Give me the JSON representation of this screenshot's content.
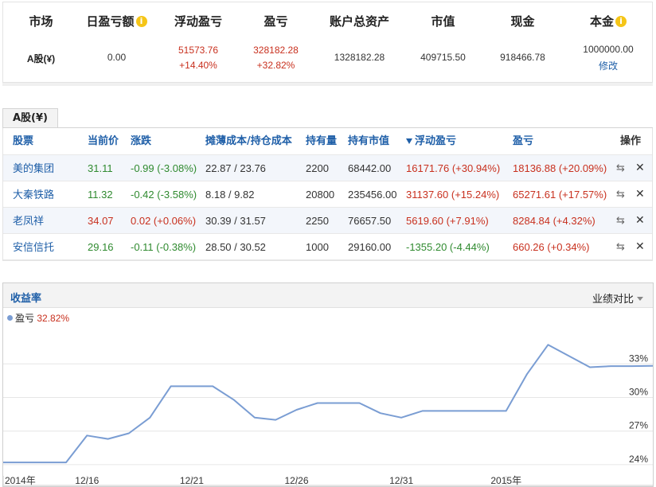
{
  "summary": {
    "headers": {
      "market": "市场",
      "daily_pnl": "日盈亏额",
      "floating_pnl": "浮动盈亏",
      "pnl": "盈亏",
      "total_assets": "账户总资产",
      "market_value": "市值",
      "cash": "现金",
      "principal": "本金"
    },
    "info_icon": "i",
    "values": {
      "market": "A股(¥)",
      "daily_pnl": "0.00",
      "floating_pnl": "51573.76",
      "floating_pnl_pct": "+14.40%",
      "pnl": "328182.28",
      "pnl_pct": "+32.82%",
      "total_assets": "1328182.28",
      "market_value": "409715.50",
      "cash": "918466.78",
      "principal": "1000000.00",
      "edit": "修改"
    }
  },
  "holdings": {
    "tab": "A股(¥)",
    "headers": {
      "stock": "股票",
      "price": "当前价",
      "change": "涨跌",
      "cost": "摊薄成本/持仓成本",
      "qty": "持有量",
      "value": "持有市值",
      "floating": "浮动盈亏",
      "pnl": "盈亏",
      "ops": "操作"
    },
    "rows": [
      {
        "name": "美的集团",
        "price": "31.11",
        "change": "-0.99 (-3.08%)",
        "cost": "22.87 / 23.76",
        "qty": "2200",
        "value": "68442.00",
        "floating": "16171.76 (+30.94%)",
        "pnl": "18136.88 (+20.09%)",
        "price_color": "green",
        "change_color": "green",
        "floating_color": "red",
        "pnl_color": "red"
      },
      {
        "name": "大秦铁路",
        "price": "11.32",
        "change": "-0.42 (-3.58%)",
        "cost": "8.18 / 9.82",
        "qty": "20800",
        "value": "235456.00",
        "floating": "31137.60 (+15.24%)",
        "pnl": "65271.61 (+17.57%)",
        "price_color": "green",
        "change_color": "green",
        "floating_color": "red",
        "pnl_color": "red"
      },
      {
        "name": "老凤祥",
        "price": "34.07",
        "change": "0.02 (+0.06%)",
        "cost": "30.39 / 31.57",
        "qty": "2250",
        "value": "76657.50",
        "floating": "5619.60 (+7.91%)",
        "pnl": "8284.84 (+4.32%)",
        "price_color": "red",
        "change_color": "red",
        "floating_color": "red",
        "pnl_color": "red"
      },
      {
        "name": "安信信托",
        "price": "29.16",
        "change": "-0.11 (-0.38%)",
        "cost": "28.50 / 30.52",
        "qty": "1000",
        "value": "29160.00",
        "floating": "-1355.20 (-4.44%)",
        "pnl": "660.26 (+0.34%)",
        "price_color": "green",
        "change_color": "green",
        "floating_color": "green",
        "pnl_color": "red"
      }
    ],
    "op_icons": [
      "transfer-icon",
      "close-icon"
    ]
  },
  "chart_panel": {
    "title": "收益率",
    "compare_label": "业绩对比",
    "legend_name": "盈亏",
    "legend_value": "32.82%"
  },
  "chart_data": {
    "type": "line",
    "x": [
      "2014-12-12",
      "2014-12-13",
      "2014-12-14",
      "2014-12-15",
      "2014-12-16",
      "2014-12-17",
      "2014-12-18",
      "2014-12-19",
      "2014-12-20",
      "2014-12-21",
      "2014-12-22",
      "2014-12-23",
      "2014-12-24",
      "2014-12-25",
      "2014-12-26",
      "2014-12-27",
      "2014-12-28",
      "2014-12-29",
      "2014-12-30",
      "2014-12-31",
      "2015-01-01",
      "2015-01-02",
      "2015-01-03",
      "2015-01-04",
      "2015-01-05",
      "2015-01-06",
      "2015-01-07",
      "2015-01-08",
      "2015-01-09",
      "2015-01-10",
      "2015-01-11",
      "2015-01-12"
    ],
    "series": [
      {
        "name": "盈亏",
        "values": [
          24.2,
          24.2,
          24.2,
          24.2,
          26.6,
          26.3,
          26.8,
          28.2,
          31.0,
          31.0,
          31.0,
          29.8,
          28.2,
          28.0,
          28.9,
          29.5,
          29.5,
          29.5,
          28.6,
          28.2,
          28.8,
          28.8,
          28.8,
          28.8,
          28.8,
          32.1,
          34.7,
          33.7,
          32.7,
          32.8,
          32.8,
          32.82
        ]
      }
    ],
    "x_ticks": [
      {
        "x": "2014-12-12",
        "label": "2014年"
      },
      {
        "x": "2014-12-16",
        "label": "12/16"
      },
      {
        "x": "2014-12-21",
        "label": "12/21"
      },
      {
        "x": "2014-12-26",
        "label": "12/26"
      },
      {
        "x": "2014-12-31",
        "label": "12/31"
      },
      {
        "x": "2015-01-05",
        "label": "2015年"
      }
    ],
    "y_ticks": [
      {
        "y": 24,
        "label": "24%"
      },
      {
        "y": 27,
        "label": "27%"
      },
      {
        "y": 30,
        "label": "30%"
      },
      {
        "y": 33,
        "label": "33%"
      }
    ],
    "ylim": [
      23.0,
      36.5
    ],
    "color": "#7a9dd3",
    "grid": true
  }
}
